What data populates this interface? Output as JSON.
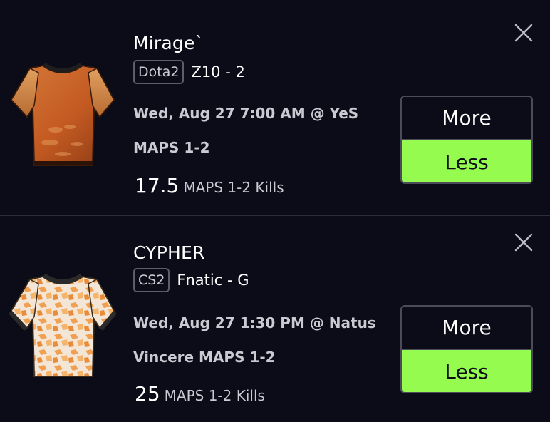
{
  "colors": {
    "background": "#0b0c17",
    "less_selected": "#95fb4f",
    "divider": "#2b2d3a"
  },
  "picks": [
    {
      "player": "Mirage`",
      "game": "Dota2",
      "team": "Z10 - 2",
      "time": "Wed, Aug 27 7:00 AM @ YeS",
      "market": "MAPS 1-2",
      "line_value": "17.5",
      "stat": "MAPS 1-2 Kills",
      "more_label": "More",
      "less_label": "Less",
      "selected": "Less",
      "jersey_icon": "orange-jersey-icon",
      "close_icon": "close-icon"
    },
    {
      "player": "CYPHER",
      "game": "CS2",
      "team": "Fnatic - G",
      "time": "Wed, Aug 27 1:30 PM @ Natus",
      "market": "Vincere MAPS 1-2",
      "line_value": "25",
      "stat": "MAPS 1-2 Kills",
      "more_label": "More",
      "less_label": "Less",
      "selected": "Less",
      "jersey_icon": "camo-jersey-icon",
      "close_icon": "close-icon"
    }
  ]
}
